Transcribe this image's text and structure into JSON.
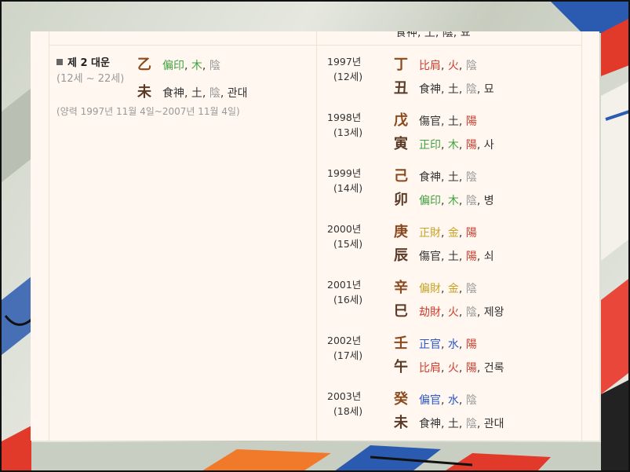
{
  "colors": {
    "panel_bg": "#fff7f0",
    "border": "#f0e3cf",
    "stem_color": "#8b4a1e",
    "branch_color": "#5a3a26",
    "green": "#3ea33e",
    "red": "#d23b2c",
    "gold": "#c9a228",
    "blue": "#2a56c8",
    "gray": "#999999"
  },
  "cut_row": {
    "text": "食神, 土, 陰, 묘"
  },
  "daeun": {
    "title": "제 2 대운",
    "range": "(12세 ~ 22세)",
    "solar": "(양력 1997년 11월 4일~2007년 11월 4일)",
    "stem": {
      "char": "乙",
      "god": "偏印",
      "element": "木",
      "yinyang": "陰"
    },
    "branch": {
      "char": "未",
      "god": "食神",
      "element": "土",
      "yinyang": "陰",
      "stage": "관대"
    }
  },
  "years": [
    {
      "year": "1997년",
      "age": "(12세)",
      "stem": {
        "char": "丁",
        "god": "比肩",
        "element": "火",
        "yinyang": "陰"
      },
      "branch": {
        "char": "丑",
        "god": "食神",
        "element": "土",
        "yinyang": "陰",
        "stage": "묘"
      }
    },
    {
      "year": "1998년",
      "age": "(13세)",
      "stem": {
        "char": "戊",
        "god": "傷官",
        "element": "土",
        "yinyang": "陽"
      },
      "branch": {
        "char": "寅",
        "god": "正印",
        "element": "木",
        "yinyang": "陽",
        "stage": "사"
      }
    },
    {
      "year": "1999년",
      "age": "(14세)",
      "stem": {
        "char": "己",
        "god": "食神",
        "element": "土",
        "yinyang": "陰"
      },
      "branch": {
        "char": "卯",
        "god": "偏印",
        "element": "木",
        "yinyang": "陰",
        "stage": "병"
      }
    },
    {
      "year": "2000년",
      "age": "(15세)",
      "stem": {
        "char": "庚",
        "god": "正財",
        "element": "金",
        "yinyang": "陽"
      },
      "branch": {
        "char": "辰",
        "god": "傷官",
        "element": "土",
        "yinyang": "陽",
        "stage": "쇠"
      }
    },
    {
      "year": "2001년",
      "age": "(16세)",
      "stem": {
        "char": "辛",
        "god": "偏財",
        "element": "金",
        "yinyang": "陰"
      },
      "branch": {
        "char": "巳",
        "god": "劫財",
        "element": "火",
        "yinyang": "陰",
        "stage": "제왕"
      }
    },
    {
      "year": "2002년",
      "age": "(17세)",
      "stem": {
        "char": "壬",
        "god": "正官",
        "element": "水",
        "yinyang": "陽"
      },
      "branch": {
        "char": "午",
        "god": "比肩",
        "element": "火",
        "yinyang": "陽",
        "stage": "건록"
      }
    },
    {
      "year": "2003년",
      "age": "(18세)",
      "stem": {
        "char": "癸",
        "god": "偏官",
        "element": "水",
        "yinyang": "陰"
      },
      "branch": {
        "char": "未",
        "god": "食神",
        "element": "土",
        "yinyang": "陰",
        "stage": "관대"
      }
    }
  ]
}
